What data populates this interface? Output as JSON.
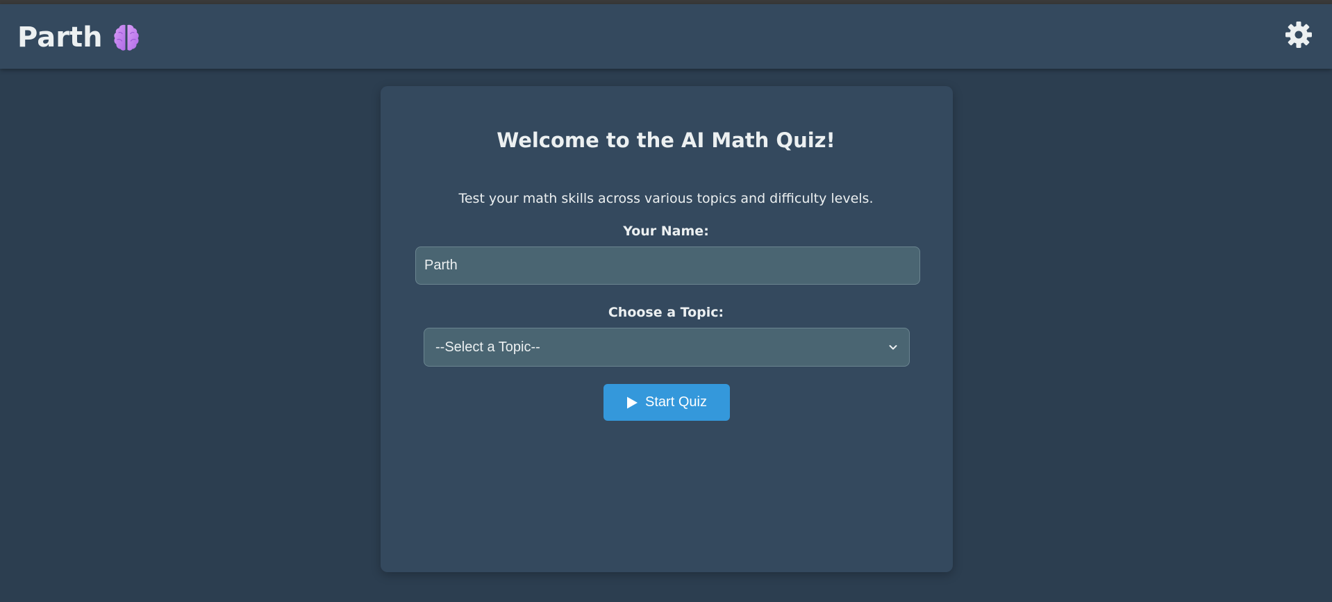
{
  "header": {
    "brand_name": "Parth",
    "brand_icon": "brain-icon",
    "settings_icon": "gear-icon"
  },
  "quiz": {
    "title": "Welcome to the AI Math Quiz!",
    "subtitle": "Test your math skills across various topics and difficulty levels.",
    "name_label": "Your Name:",
    "name_value": "Parth",
    "topic_label": "Choose a Topic:",
    "topic_selected": "--Select a Topic--",
    "start_label": "Start Quiz",
    "start_icon": "play-icon"
  },
  "colors": {
    "background": "#2c3e50",
    "header": "#34495e",
    "card": "#34495e",
    "input": "#4a6572",
    "accent": "#3498db",
    "brain": "#c984f0"
  }
}
